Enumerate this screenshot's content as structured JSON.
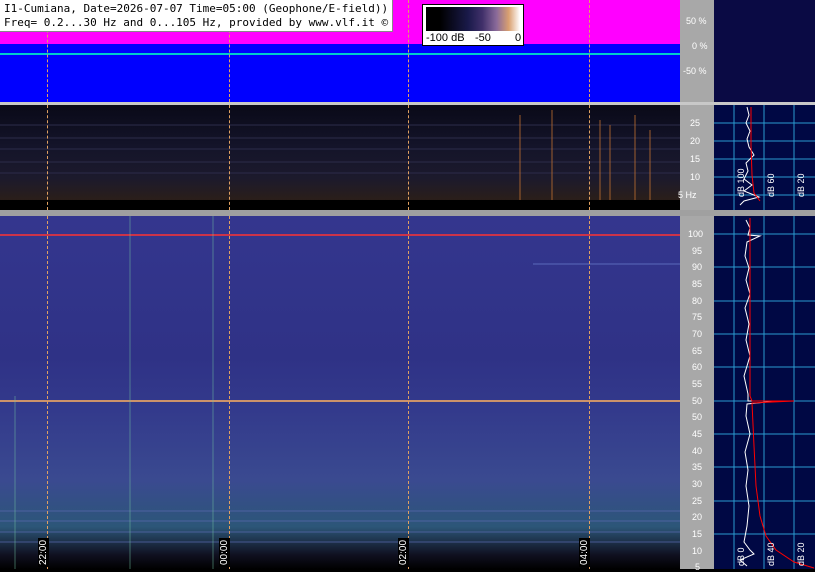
{
  "header": {
    "title_line1": "I1-Cumiana, Date=2026-07-07 Time=05:00 (Geophone/E-field))",
    "title_line2": "Freq= 0.2...30 Hz and 0...105 Hz, provided by www.vlf.it ©"
  },
  "colorbar": {
    "low": "-100 dB",
    "mid": "-50",
    "high": "0"
  },
  "amplitude_axis": {
    "ticks": [
      "50 %",
      "0 %",
      "-50 %"
    ]
  },
  "low_freq_axis": {
    "ticks": [
      "25",
      "20",
      "15",
      "10",
      "5 Hz"
    ]
  },
  "high_freq_axis": {
    "ticks": [
      "100",
      "95",
      "90",
      "85",
      "80",
      "75",
      "70",
      "65",
      "60",
      "55",
      "50",
      "45",
      "40",
      "35",
      "30",
      "25",
      "20",
      "15",
      "10",
      "5"
    ]
  },
  "spectrum_top_labels": [
    "dB 100",
    "dB 60",
    "dB 20"
  ],
  "spectrum_bottom_labels": [
    "dB 0",
    "dB 40",
    "dB 20"
  ],
  "time_labels": [
    "22:00",
    "00:00",
    "02:00",
    "04:00"
  ],
  "colors": {
    "amplitude_bg": "#0000ff",
    "amplitude_signal": "#ff00ff",
    "grid_dash": "#e0a060",
    "mains_line": "#ff3333",
    "spectrum_trace": "#ffffff",
    "spectrum_fit": "#ff0000",
    "grid_cyan": "#2a9ad0"
  }
}
